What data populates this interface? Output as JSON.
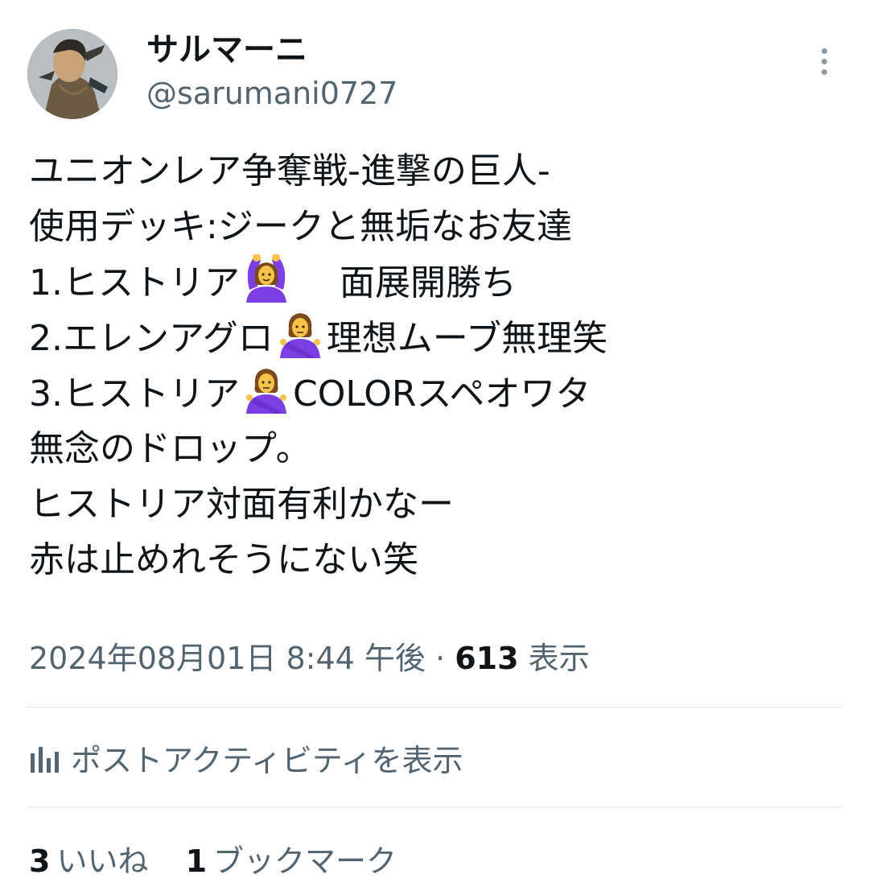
{
  "author": {
    "display_name": "サルマーニ",
    "handle": "@sarumani0727"
  },
  "icons": {
    "more": "more-vertical-icon",
    "activity": "bar-chart-icon",
    "emoji_ok": "person-gesturing-ok-emoji",
    "emoji_no": "person-gesturing-no-emoji"
  },
  "tweet": {
    "line1": "ユニオンレア争奪戦-進撃の巨人-",
    "line2": "使用デッキ:ジークと無垢なお友達",
    "line3_a": "1.ヒストリア",
    "line3_b": "面展開勝ち",
    "line4_a": "2.エレンアグロ",
    "line4_b": "理想ムーブ無理笑",
    "line5_a": "3.ヒストリア",
    "line5_b": "COLORスペオワタ",
    "line6": "無念のドロップ。",
    "line7": "ヒストリア対面有利かなー",
    "line8": "赤は止めれそうにない笑"
  },
  "meta": {
    "timestamp": "2024年08月01日 8:44 午後",
    "separator": "·",
    "views_count": "613",
    "views_label": "表示"
  },
  "activity_label": "ポストアクティビティを表示",
  "stats": {
    "likes_count": "3",
    "likes_label": "いいね",
    "bookmarks_count": "1",
    "bookmarks_label": "ブックマーク"
  },
  "colors": {
    "text": "#0f1419",
    "secondary": "#536471",
    "divider": "#e1e6ea",
    "emoji_shirt": "#7b3fe4",
    "emoji_skin": "#f6c24a"
  }
}
